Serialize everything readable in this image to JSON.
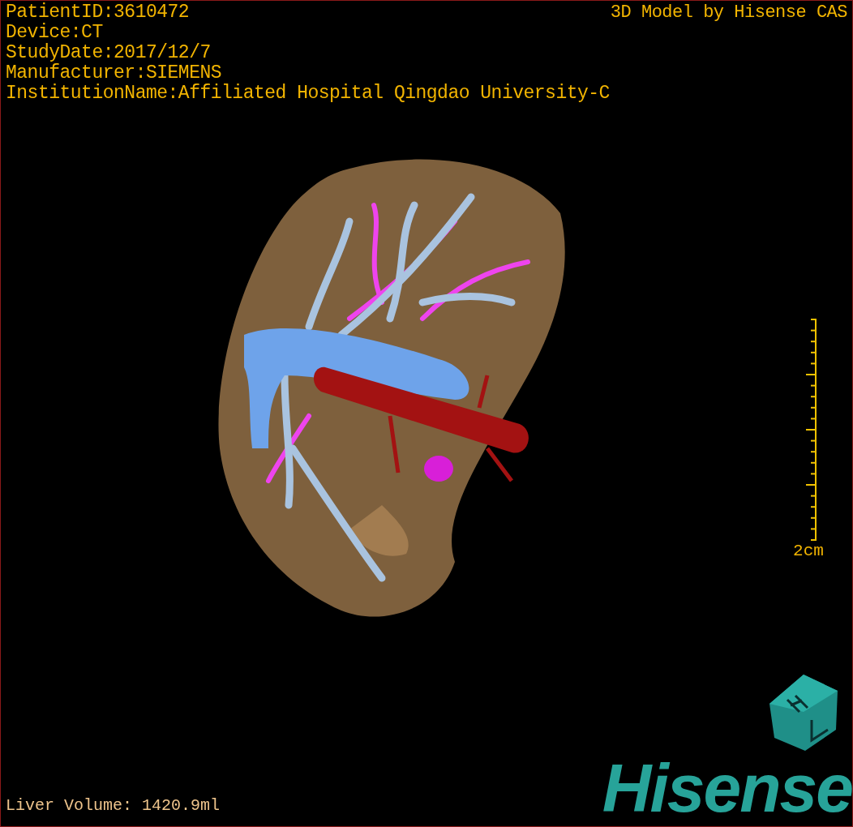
{
  "info_lines": [
    "PatientID:3610472",
    "Device:CT",
    "StudyDate:2017/12/7",
    "Manufacturer:SIEMENS",
    "InstitutionName:Affiliated Hospital Qingdao University-C"
  ],
  "credit": "3D Model by Hisense CAS",
  "scale": {
    "label": "2cm"
  },
  "volume": "Liver Volume: 1420.9ml",
  "brand": "Hisense"
}
